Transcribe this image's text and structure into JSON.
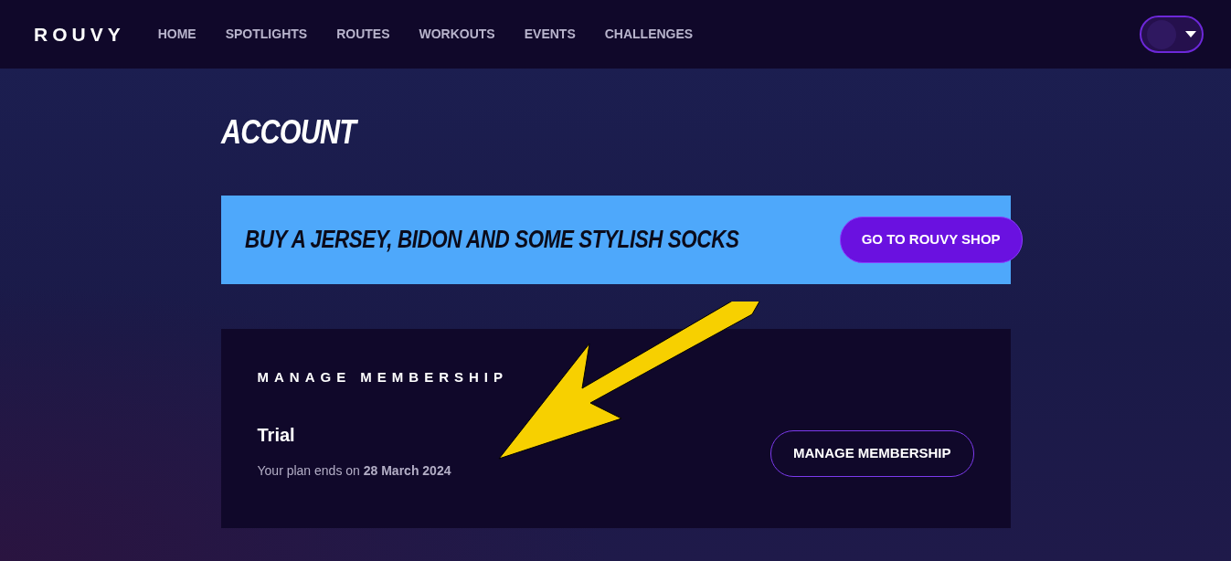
{
  "navbar": {
    "logo": "ROUVY",
    "links": [
      {
        "label": "HOME",
        "selected": false
      },
      {
        "label": "SPOTLIGHTS",
        "selected": false
      },
      {
        "label": "ROUTES",
        "selected": false
      },
      {
        "label": "WORKOUTS",
        "selected": false
      },
      {
        "label": "EVENTS",
        "selected": false
      },
      {
        "label": "CHALLENGES",
        "selected": false
      }
    ]
  },
  "page_title": "ACCOUNT",
  "banner": {
    "text": "BUY A JERSEY, BIDON AND SOME STYLISH SOCKS",
    "button": "GO TO ROUVY SHOP"
  },
  "membership": {
    "heading": "MANAGE MEMBERSHIP",
    "plan": "Trial",
    "note": "Your plan ends on **28 March 2024**",
    "button": "MANAGE MEMBERSHIP"
  }
}
